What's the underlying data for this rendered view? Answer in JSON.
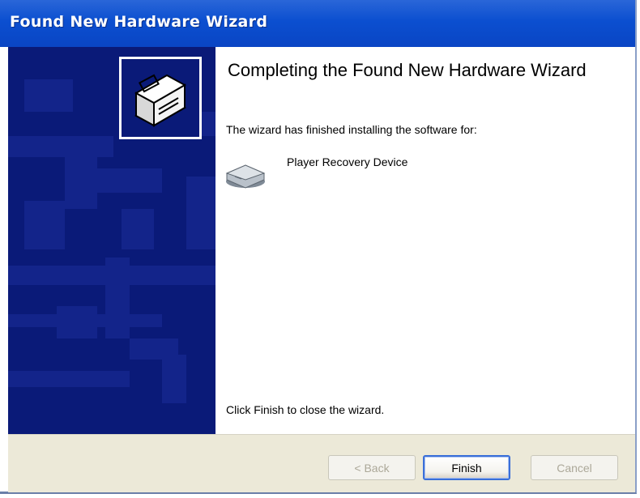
{
  "window": {
    "title": "Found New Hardware Wizard"
  },
  "sidebar": {
    "icon": "hardware-box-icon",
    "background_color": "#0a1a78"
  },
  "main": {
    "heading": "Completing the Found New Hardware Wizard",
    "description": "The wizard has finished installing the software for:",
    "device": {
      "icon": "drive-icon",
      "name": "Player Recovery Device"
    },
    "closing_text": "Click Finish to close the wizard."
  },
  "buttons": {
    "back_label": "< Back",
    "finish_label": "Finish",
    "cancel_label": "Cancel"
  },
  "colors": {
    "titlebar": "#0b4fd0",
    "accent": "#3a6fd8",
    "footer": "#ece9d8"
  }
}
